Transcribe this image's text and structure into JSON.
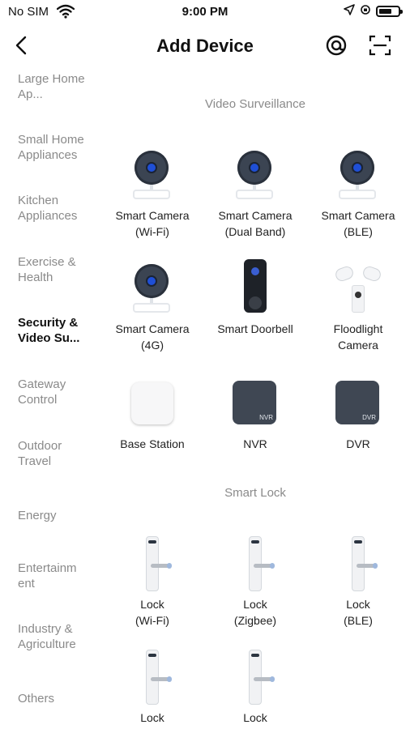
{
  "status_bar": {
    "carrier": "No SIM",
    "time": "9:00 PM"
  },
  "header": {
    "title": "Add Device"
  },
  "sidebar": {
    "items": [
      {
        "label": "Large Home Ap...",
        "active": false
      },
      {
        "label": "Small Home Appliances",
        "active": false
      },
      {
        "label": "Kitchen Appliances",
        "active": false
      },
      {
        "label": "Exercise & Health",
        "active": false
      },
      {
        "label": "Security & Video Su...",
        "active": true
      },
      {
        "label": "Gateway Control",
        "active": false
      },
      {
        "label": "Outdoor Travel",
        "active": false
      },
      {
        "label": "Energy",
        "active": false
      },
      {
        "label": "Entertainm ent",
        "active": false
      },
      {
        "label": "Industry & Agriculture",
        "active": false
      },
      {
        "label": "Others",
        "active": false
      }
    ]
  },
  "sections": [
    {
      "title": "Video Surveillance",
      "devices": [
        {
          "name": "Smart Camera",
          "sub": "(Wi-Fi)",
          "icon": "camera-icon"
        },
        {
          "name": "Smart Camera",
          "sub": "(Dual Band)",
          "icon": "camera-icon"
        },
        {
          "name": "Smart Camera",
          "sub": "(BLE)",
          "icon": "camera-icon"
        },
        {
          "name": "Smart Camera",
          "sub": "(4G)",
          "icon": "camera-icon"
        },
        {
          "name": "Smart Doorbell",
          "sub": "",
          "icon": "doorbell-icon"
        },
        {
          "name": "Floodlight",
          "sub": "Camera",
          "icon": "floodlight-camera-icon"
        },
        {
          "name": "Base Station",
          "sub": "",
          "icon": "base-station-icon"
        },
        {
          "name": "NVR",
          "sub": "",
          "icon": "nvr-icon",
          "tag": "NVR"
        },
        {
          "name": "DVR",
          "sub": "",
          "icon": "dvr-icon",
          "tag": "DVR"
        }
      ]
    },
    {
      "title": "Smart Lock",
      "devices": [
        {
          "name": "Lock",
          "sub": "(Wi-Fi)",
          "icon": "lock-icon"
        },
        {
          "name": "Lock",
          "sub": "(Zigbee)",
          "icon": "lock-icon"
        },
        {
          "name": "Lock",
          "sub": "(BLE)",
          "icon": "lock-icon"
        },
        {
          "name": "Lock",
          "sub": "",
          "icon": "lock-icon"
        },
        {
          "name": "Lock",
          "sub": "",
          "icon": "lock-icon"
        }
      ]
    }
  ]
}
